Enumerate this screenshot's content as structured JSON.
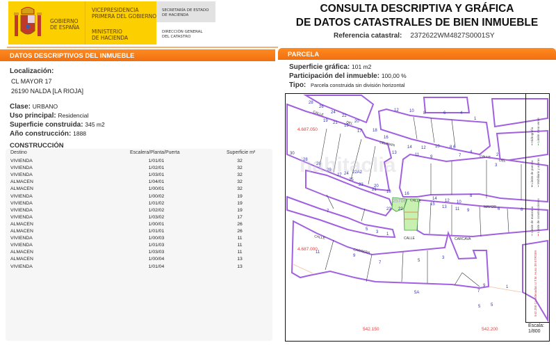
{
  "header": {
    "logo": {
      "gobierno": [
        "GOBIERNO",
        "DE ESPAÑA"
      ],
      "vicepresidencia": [
        "VICEPRESIDENCIA",
        "PRIMERA DEL GOBIERNO"
      ],
      "ministerio": [
        "MINISTERIO",
        "DE HACIENDA"
      ],
      "secretaria": [
        "SECRETARÍA DE ESTADO",
        "DE HACIENDA"
      ],
      "direccion": [
        "DIRECCIÓN GENERAL",
        "DEL CATASTRO"
      ]
    },
    "title_line1": "CONSULTA DESCRIPTIVA Y GRÁFICA",
    "title_line2": "DE DATOS CATASTRALES DE BIEN INMUEBLE",
    "ref_label": "Referencia catastral:",
    "ref_value": "2372622WM4827S0001SY"
  },
  "left": {
    "section_title": "DATOS DESCRIPTIVOS DEL INMUEBLE",
    "localizacion_label": "Localización:",
    "address1": "CL MAYOR 17",
    "address2": "26190 NALDA [LA RIOJA]",
    "clase_label": "Clase:",
    "clase": "URBANO",
    "uso_label": "Uso principal:",
    "uso": "Residencial",
    "superficie_label": "Superficie construida:",
    "superficie": "345 m2",
    "anio_label": "Año construcción:",
    "anio": "1888",
    "construccion_title": "CONSTRUCCIÓN",
    "columns": [
      "Destino",
      "Escalera/Planta/Puerta",
      "Superficie m²"
    ],
    "rows": [
      [
        "VIVIENDA",
        "1/01/01",
        "32"
      ],
      [
        "VIVIENDA",
        "1/02/01",
        "32"
      ],
      [
        "VIVIENDA",
        "1/03/01",
        "32"
      ],
      [
        "ALMACEN",
        "1/04/01",
        "32"
      ],
      [
        "ALMACEN",
        "1/00/01",
        "32"
      ],
      [
        "VIVIENDA",
        "1/00/02",
        "19"
      ],
      [
        "VIVIENDA",
        "1/01/02",
        "19"
      ],
      [
        "VIVIENDA",
        "1/02/02",
        "19"
      ],
      [
        "VIVIENDA",
        "1/03/02",
        "17"
      ],
      [
        "ALMACEN",
        "1/00/01",
        "26"
      ],
      [
        "ALMACEN",
        "1/01/01",
        "26"
      ],
      [
        "VIVIENDA",
        "1/00/03",
        "11"
      ],
      [
        "VIVIENDA",
        "1/01/03",
        "11"
      ],
      [
        "ALMACEN",
        "1/03/03",
        "11"
      ],
      [
        "ALMACEN",
        "1/00/04",
        "13"
      ],
      [
        "VIVIENDA",
        "1/01/04",
        "13"
      ]
    ]
  },
  "right": {
    "section_title": "PARCELA",
    "sup_label": "Superficie gráfica:",
    "sup": "101 m2",
    "part_label": "Participación del inmueble:",
    "part": "100,00 %",
    "tipo_label": "Tipo:",
    "tipo": "Parcela construida sin división horizontal"
  },
  "map": {
    "streets": [
      "CALLE",
      "DEL",
      "CELEMIN",
      "CALLE",
      "DEL",
      "CALLE",
      "MAYOR",
      "CALLE",
      "CARRERA",
      "CALLE",
      "CARCAVA"
    ],
    "coords": [
      "4.687.050",
      "4.687.000",
      "542.150",
      "542.200"
    ],
    "parcel_ref": "25706",
    "numbers": [
      "28",
      "26",
      "24",
      "22",
      "20",
      "19",
      "21",
      "19",
      "17",
      "18",
      "16",
      "12",
      "10",
      "8",
      "6",
      "4",
      "1",
      "14",
      "12",
      "10",
      "8 6",
      "4",
      "13",
      "11",
      "9",
      "7",
      "3",
      "2",
      "30",
      "28",
      "26",
      "29",
      "27",
      "24",
      "25",
      "23",
      "21",
      "22A2",
      "20",
      "18",
      "16",
      "14",
      "12",
      "10",
      "15",
      "13",
      "11",
      "9",
      "8",
      "6",
      "23",
      "22",
      "7",
      "5",
      "3",
      "1",
      "11",
      "9",
      "7",
      "5",
      "3",
      "1",
      "9",
      "7",
      "5A",
      "5",
      "5",
      "6"
    ],
    "legend": {
      "coord_note": "542.200 Coordenadas U.T.M. Huso 30 ETRS89",
      "items": [
        "Límite de manzana",
        "Límite de construcciones",
        "Límite de parcela",
        "Mobiliario y aceras",
        "Hidrografía",
        "Límite zona verde"
      ]
    },
    "scale_label": "Escala:",
    "scale": "1/800",
    "watermark": "habitaclia"
  },
  "colors": {
    "accent": "#f07d1a",
    "logo_yellow": "#fcd000",
    "block_outline": "#a060e0",
    "coord_red": "#e04040",
    "green_parcel": "#c8f0b0"
  }
}
